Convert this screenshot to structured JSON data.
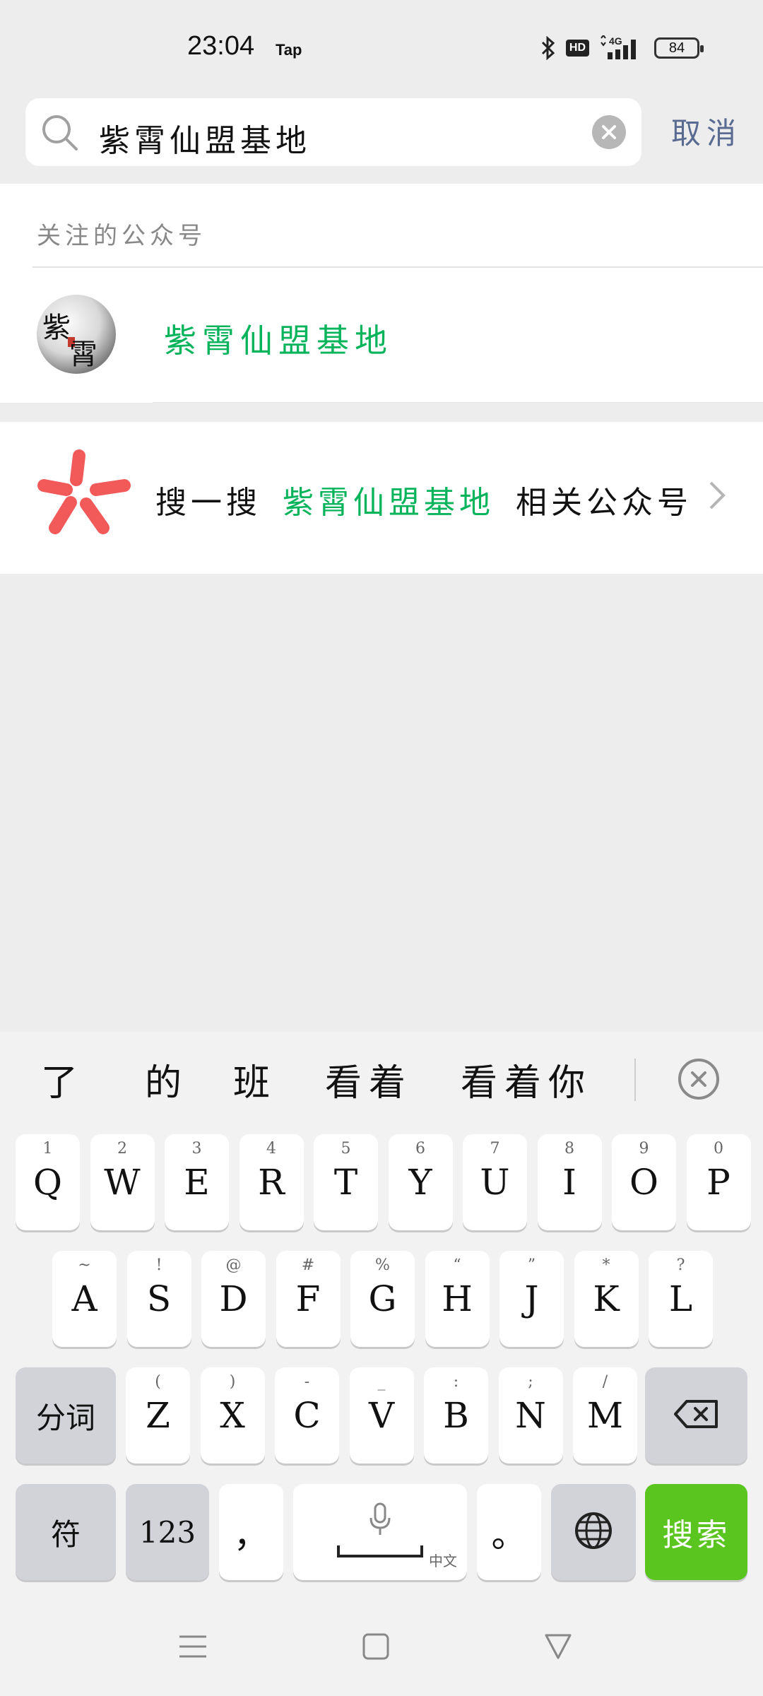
{
  "status_bar": {
    "time": "23:04",
    "app_label": "Tap",
    "hd": "HD",
    "network": "4G",
    "battery": "84"
  },
  "search": {
    "query": "紫霄仙盟基地",
    "cancel": "取消"
  },
  "followed": {
    "section_title": "关注的公众号",
    "account_name": "紫霄仙盟基地",
    "avatar_chars": [
      "紫",
      "霄"
    ]
  },
  "related": {
    "prefix": "搜一搜",
    "keyword": "紫霄仙盟基地",
    "suffix": "相关公众号"
  },
  "keyboard": {
    "suggestions": [
      "了",
      "的",
      "班",
      "看着",
      "看着你"
    ],
    "row1": [
      {
        "main": "Q",
        "sub": "1"
      },
      {
        "main": "W",
        "sub": "2"
      },
      {
        "main": "E",
        "sub": "3"
      },
      {
        "main": "R",
        "sub": "4"
      },
      {
        "main": "T",
        "sub": "5"
      },
      {
        "main": "Y",
        "sub": "6"
      },
      {
        "main": "U",
        "sub": "7"
      },
      {
        "main": "I",
        "sub": "8"
      },
      {
        "main": "O",
        "sub": "9"
      },
      {
        "main": "P",
        "sub": "0"
      }
    ],
    "row2": [
      {
        "main": "A",
        "sub": "~"
      },
      {
        "main": "S",
        "sub": "!"
      },
      {
        "main": "D",
        "sub": "@"
      },
      {
        "main": "F",
        "sub": "#"
      },
      {
        "main": "G",
        "sub": "%"
      },
      {
        "main": "H",
        "sub": "“"
      },
      {
        "main": "J",
        "sub": "”"
      },
      {
        "main": "K",
        "sub": "*"
      },
      {
        "main": "L",
        "sub": "?"
      }
    ],
    "row3": [
      {
        "main": "Z",
        "sub": "("
      },
      {
        "main": "X",
        "sub": ")"
      },
      {
        "main": "C",
        "sub": "-"
      },
      {
        "main": "V",
        "sub": "_"
      },
      {
        "main": "B",
        "sub": ":"
      },
      {
        "main": "N",
        "sub": ";"
      },
      {
        "main": "M",
        "sub": "/"
      }
    ],
    "split_key": "分词",
    "symbol_key": "符",
    "num_key": "123",
    "comma_key": "，",
    "space_lang": "中文",
    "period_key": "。",
    "search_key": "搜索"
  },
  "colors": {
    "accent_green": "#07b45b",
    "search_key_green": "#5ac51f",
    "cancel_blue": "#5a6b91"
  },
  "icons": {
    "search": "search-icon",
    "clear": "clear-icon",
    "soso": "soso-icon",
    "chevron": "chevron-right-icon",
    "backspace": "backspace-icon",
    "mic": "microphone-icon",
    "globe": "globe-icon",
    "menu": "menu-icon",
    "home": "home-icon",
    "back": "back-icon"
  }
}
